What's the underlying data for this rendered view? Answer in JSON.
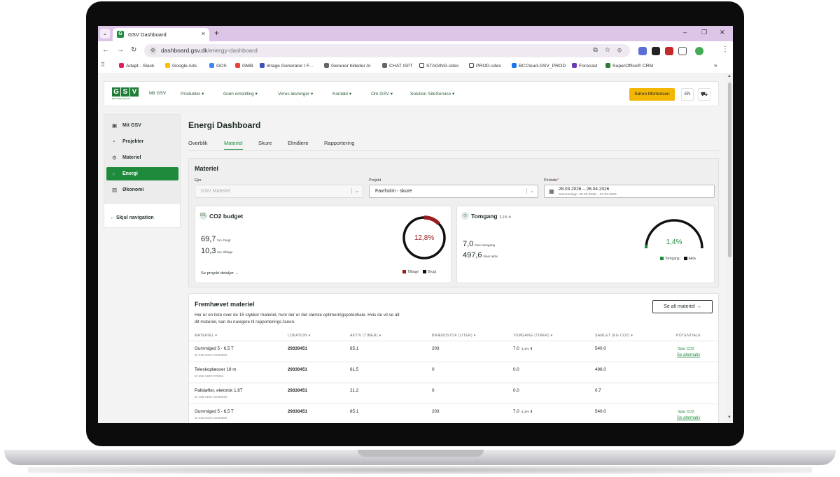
{
  "browser": {
    "tab_title": "GSV Dashboard",
    "tab_favicon": "G",
    "tab_close": "×",
    "new_tab": "+",
    "tab_list": "⌄",
    "url_domain": "dashboard.gsv.dk",
    "url_path": "/energy-dashboard",
    "window_controls": {
      "minimize": "–",
      "restore": "❐",
      "close": "✕"
    },
    "nav": {
      "back": "←",
      "forward": "→",
      "reload": "↻"
    },
    "omnibox_icons": "⧉ ☆ ⊕",
    "bookmarks": [
      "Adapt - Slack",
      "Google Ads",
      "GDS",
      "GMB",
      "Image Generator I F...",
      "Generer billeder AI",
      "CHAT GPT",
      "STAGING-sites",
      "PROD-sites",
      "BCCloud-GSV_PROD",
      "Forecast",
      "SuperOffice® CRM"
    ],
    "bookmarks_more": "»",
    "apps_icon": "⠿"
  },
  "header": {
    "logo_letters": [
      "G",
      "S",
      "V"
    ],
    "logo_sub": "BUILDING GROUP",
    "nav": [
      "Mit GSV",
      "Produkter ▾",
      "Grøn omstilling ▾",
      "Vores løsninger ▾",
      "Kontakt ▾",
      "Om GSV ▾",
      "Solution SiteService ▾"
    ],
    "user": "Søren Mortensen",
    "lang": "EN",
    "cart": "⛟"
  },
  "sidebar": {
    "items": [
      {
        "label": "Mit GSV",
        "icon": "▣"
      },
      {
        "label": "Projekter",
        "icon": "◔"
      },
      {
        "label": "Materiel",
        "icon": "⚙"
      },
      {
        "label": "Energi",
        "icon": "◌"
      },
      {
        "label": "Økonomi",
        "icon": "▥"
      }
    ],
    "hide_nav": "←   Skjul navigation"
  },
  "main": {
    "title": "Energi Dashboard",
    "tabs": [
      "Overblik",
      "Materiel",
      "Skure",
      "Elmålere",
      "Rapportering"
    ],
    "active_tab": "Materiel"
  },
  "materiel": {
    "title": "Materiel",
    "owner_label": "Ejer",
    "owner_value": "GSV Materiel",
    "project_label": "Projekt",
    "project_value": "Favrholm - skure",
    "period_label": "Periode",
    "period_req": "*",
    "period_value": "28.03.2026 – 26.04.2026",
    "period_compare": "Sammenlign: 26.02.2026 – 27.03.2026",
    "chevron": "⌄",
    "calendar_icon": "▦"
  },
  "co2": {
    "icon": "CO₂",
    "title": "CO2 budget",
    "used_value": "69,7",
    "used_unit": "ton. brugt",
    "remaining_value": "10,3",
    "remaining_unit": "ton. tilbage",
    "link": "Se projekt detaljer  →",
    "gauge_label": "12,8%",
    "gauge_fraction": 0.128,
    "legend_remaining": "Tilbage",
    "legend_used": "Brugt",
    "color_remaining": "#9b1c1c",
    "color_used": "#111111"
  },
  "idle": {
    "icon": "◷",
    "title": "Tomgang",
    "title_small": "3,1% ⬆",
    "idle_value": "7,0",
    "idle_unit": "timer tomgang",
    "active_value": "497,6",
    "active_unit": "timer aktiv",
    "gauge_label": "1,4%",
    "gauge_fraction": 0.014,
    "legend_idle": "Tomgang",
    "legend_active": "Aktiv",
    "color_idle": "#1e8a3c",
    "color_active": "#111111"
  },
  "featured": {
    "title": "Fremhævet materiel",
    "description": "Her er en liste over de 15 stykker materiel, hvor der er det største optimeringspotentiale. Hvis du vil se alt dit materiel, kan du navigere til rapporterings-fanen.",
    "see_all": "Se alt materiel  →",
    "columns": [
      "MATERIEL ▾",
      "LOKATION ▾",
      "AKTIV (TIMER) ▾",
      "BRÆNDSTOF (LITER) ▾",
      "TOMGANG (TIMER) ▾",
      "SAMLET (KG CO2) ▾",
      "POTENTIALE"
    ],
    "rows": [
      {
        "name": "Gummiged 5 - 6,5 T",
        "id": "ID 036-1019-24003850",
        "location": "29330451",
        "active": "85.1",
        "fuel": "203",
        "idle": "7.0",
        "idle_pct": "3,1% ⬆",
        "total": "540.0",
        "potential1": "Spar CO2",
        "potential2": "Se alternativ"
      },
      {
        "name": "Teleskoplæsser 18 m",
        "id": "ID 256-1599-975051",
        "location": "29330451",
        "active": "61.5",
        "fuel": "0",
        "idle": "0.0",
        "idle_pct": "",
        "total": "496.0",
        "potential1": "",
        "potential2": ""
      },
      {
        "name": "Pallsløfter, elektrisk 1,6T",
        "id": "ID 158-2160-22008040",
        "location": "29330451",
        "active": "21.2",
        "fuel": "0",
        "idle": "0.0",
        "idle_pct": "",
        "total": "0.7",
        "potential1": "",
        "potential2": ""
      },
      {
        "name": "Gummiged 5 - 6,5 T",
        "id": "ID 036-1019-24003850",
        "location": "29330451",
        "active": "85.1",
        "fuel": "203",
        "idle": "7.0",
        "idle_pct": "3,1% ⬆",
        "total": "540.0",
        "potential1": "Spar CO2",
        "potential2": "Se alternativ"
      }
    ]
  }
}
